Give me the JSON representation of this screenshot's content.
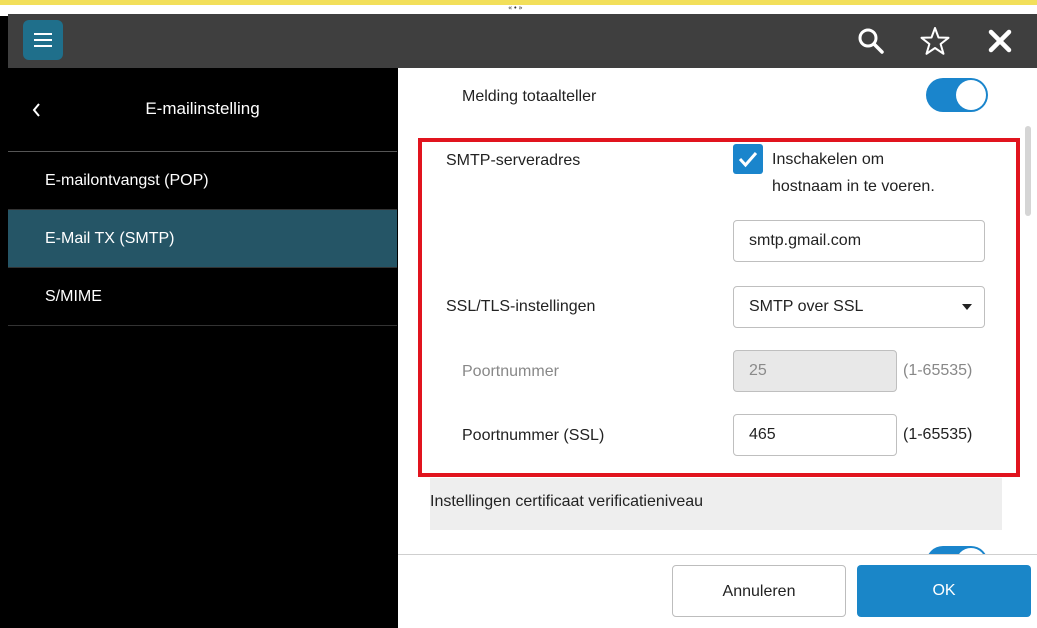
{
  "appbar": {
    "menu_icon": "menu-icon",
    "search_icon": "search-icon",
    "favorite_icon": "star-icon",
    "close_icon": "close-icon"
  },
  "sidebar": {
    "title": "E-mailinstelling",
    "back_icon": "chevron-left-icon",
    "items": [
      {
        "label": "E-mailontvangst (POP)",
        "active": false
      },
      {
        "label": "E-Mail TX (SMTP)",
        "active": true
      },
      {
        "label": "S/MIME",
        "active": false
      }
    ]
  },
  "content": {
    "total_counter": {
      "label": "Melding totaalteller",
      "enabled": true
    },
    "smtp_server": {
      "label": "SMTP-serveradres",
      "hostname_checkbox_label_line1": "Inschakelen om",
      "hostname_checkbox_label_line2": "hostnaam in te voeren.",
      "hostname_checked": true,
      "value": "smtp.gmail.com"
    },
    "ssl_tls": {
      "label": "SSL/TLS-instellingen",
      "value": "SMTP over SSL"
    },
    "port": {
      "label": "Poortnummer",
      "value": "25",
      "range": "(1-65535)"
    },
    "port_ssl": {
      "label": "Poortnummer (SSL)",
      "value": "465",
      "range": "(1-65535)"
    },
    "certificate_section": "Instellingen certificaat verificatieniveau"
  },
  "footer": {
    "cancel_label": "Annuleren",
    "ok_label": "OK"
  },
  "colors": {
    "accent": "#1a85cc",
    "highlight": "#e1141e",
    "sidebar_active": "#255566"
  }
}
